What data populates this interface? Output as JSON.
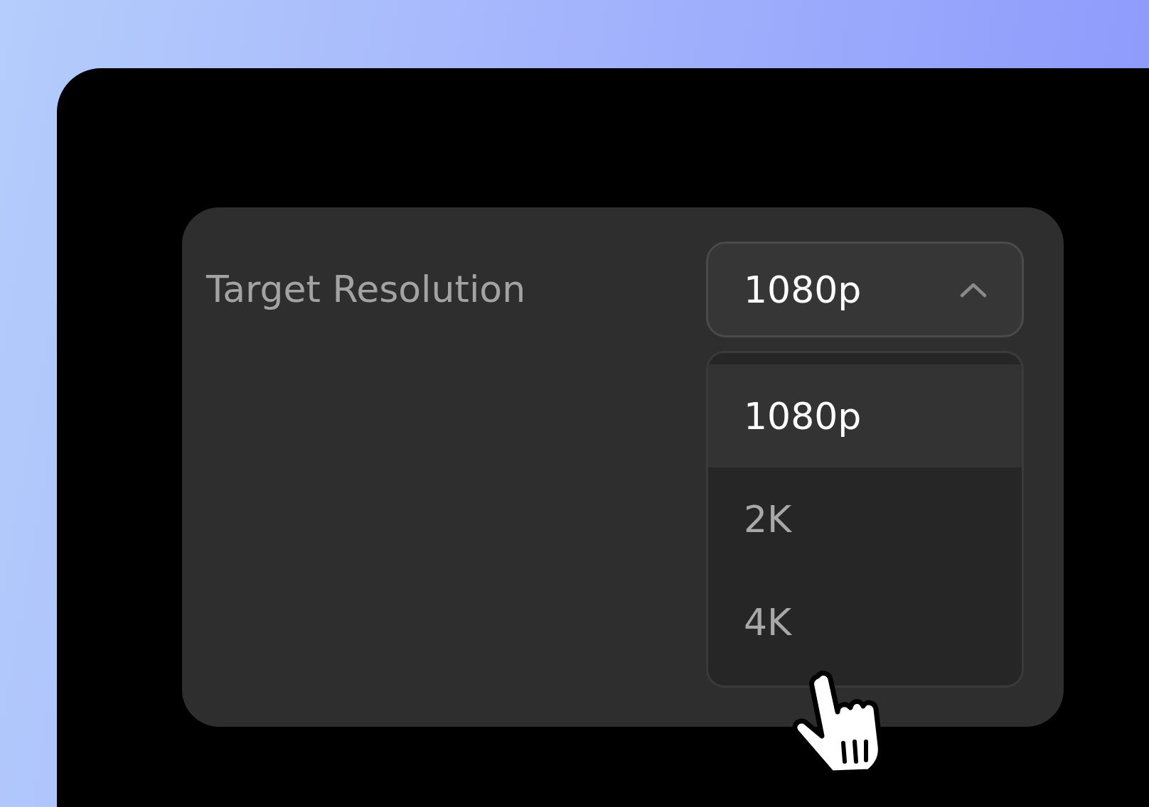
{
  "setting": {
    "label": "Target Resolution"
  },
  "select": {
    "value": "1080p",
    "expanded": true,
    "options": [
      {
        "label": "1080p",
        "selected": true
      },
      {
        "label": "2K",
        "selected": false
      },
      {
        "label": "4K",
        "selected": false
      }
    ]
  }
}
